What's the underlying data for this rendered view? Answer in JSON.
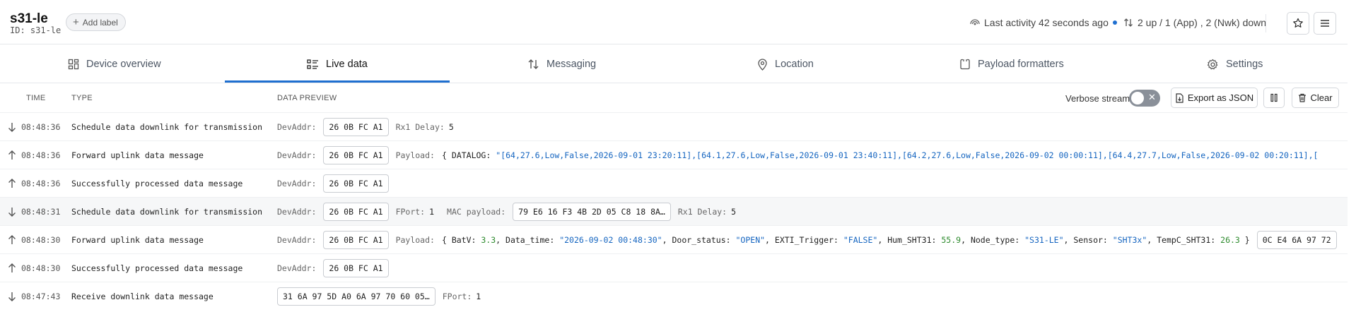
{
  "header": {
    "device_name": "s31-le",
    "device_id": "ID: s31-le",
    "add_label": "Add label",
    "last_activity": "Last activity 42 seconds ago",
    "traffic": "2 up / 1 (App) , 2 (Nwk) down"
  },
  "tabs": [
    {
      "label": "Device overview",
      "icon": "overview-icon"
    },
    {
      "label": "Live data",
      "icon": "list-icon",
      "active": true
    },
    {
      "label": "Messaging",
      "icon": "up-down-arrows-icon"
    },
    {
      "label": "Location",
      "icon": "location-pin-icon"
    },
    {
      "label": "Payload formatters",
      "icon": "code-icon"
    },
    {
      "label": "Settings",
      "icon": "gear-icon"
    }
  ],
  "table": {
    "col_time": "TIME",
    "col_type": "TYPE",
    "col_preview": "DATA PREVIEW",
    "verbose_label": "Verbose stream",
    "verbose_on": false,
    "export_label": "Export as JSON",
    "clear_label": "Clear"
  },
  "rows": [
    {
      "dir": "down",
      "time": "08:48:36",
      "type": "Schedule data downlink for transmission",
      "devaddr_key": "DevAddr:",
      "devaddr": "26 0B FC A1",
      "extra_key": "Rx1 Delay:",
      "extra_val": "5"
    },
    {
      "dir": "up",
      "time": "08:48:36",
      "type": "Forward uplink data message",
      "devaddr_key": "DevAddr:",
      "devaddr": "26 0B FC A1",
      "payload_key": "Payload:",
      "payload_open": "{",
      "payload_field": "DATALOG:",
      "payload_value": "\"[64,27.6,Low,False,2026-09-01 23:20:11],[64.1,27.6,Low,False,2026-09-01 23:40:11],[64.2,27.6,Low,False,2026-09-02 00:00:11],[64.4,27.7,Low,False,2026-09-02 00:20:11],["
    },
    {
      "dir": "up",
      "time": "08:48:36",
      "type": "Successfully processed data message",
      "devaddr_key": "DevAddr:",
      "devaddr": "26 0B FC A1"
    },
    {
      "dir": "down",
      "time": "08:48:31",
      "type": "Schedule data downlink for transmission",
      "devaddr_key": "DevAddr:",
      "devaddr": "26 0B FC A1",
      "fport_key": "FPort:",
      "fport": "1",
      "mac_key": "MAC payload:",
      "mac": "79 E6 16 F3 4B 2D 05 C8 18 8A…",
      "extra_key": "Rx1 Delay:",
      "extra_val": "5",
      "alt": true
    },
    {
      "dir": "up",
      "time": "08:48:30",
      "type": "Forward uplink data message",
      "devaddr_key": "DevAddr:",
      "devaddr": "26 0B FC A1",
      "payload_key": "Payload:",
      "fields": [
        {
          "k": "BatV:",
          "v": "3.3",
          "t": "num"
        },
        {
          "k": "Data_time:",
          "v": "\"2026-09-02 00:48:30\"",
          "t": "str"
        },
        {
          "k": "Door_status:",
          "v": "\"OPEN\"",
          "t": "str"
        },
        {
          "k": "EXTI_Trigger:",
          "v": "\"FALSE\"",
          "t": "str"
        },
        {
          "k": "Hum_SHT31:",
          "v": "55.9",
          "t": "num"
        },
        {
          "k": "Node_type:",
          "v": "\"S31-LE\"",
          "t": "str"
        },
        {
          "k": "Sensor:",
          "v": "\"SHT3x\"",
          "t": "str"
        },
        {
          "k": "TempC_SHT31:",
          "v": "26.3",
          "t": "num"
        }
      ],
      "raw": "0C E4 6A 97 72"
    },
    {
      "dir": "up",
      "time": "08:48:30",
      "type": "Successfully processed data message",
      "devaddr_key": "DevAddr:",
      "devaddr": "26 0B FC A1"
    },
    {
      "dir": "down",
      "time": "08:47:43",
      "type": "Receive downlink data message",
      "raw_payload": "31 6A 97 5D A0 6A 97 70 60 05…",
      "fport_key": "FPort:",
      "fport": "1"
    }
  ],
  "colors": {
    "accent": "#1f6fd0",
    "string": "#1565c0",
    "number": "#2e8b2e"
  }
}
